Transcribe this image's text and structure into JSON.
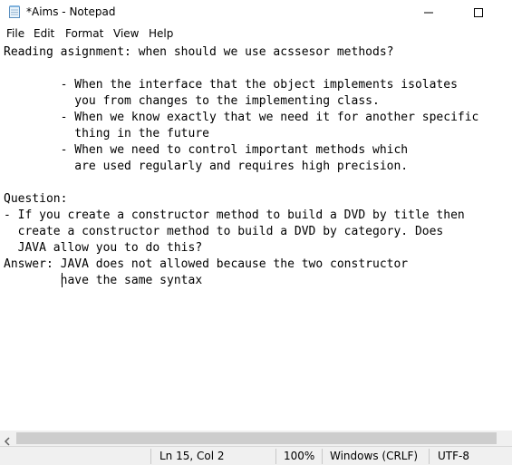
{
  "window": {
    "title": "*Aims - Notepad",
    "icon": "notepad-icon",
    "controls": [
      "minimize-icon",
      "maximize-icon"
    ]
  },
  "menu": {
    "items": [
      "File",
      "Edit",
      "Format",
      "View",
      "Help"
    ]
  },
  "editor": {
    "lines": [
      "Reading asignment: when should we use acssesor methods?",
      "",
      "        - When the interface that the object implements isolates",
      "          you from changes to the implementing class.",
      "        - When we know exactly that we need it for another specific",
      "          thing in the future",
      "        - When we need to control important methods which",
      "          are used regularly and requires high precision.",
      "",
      "Question:",
      "- If you create a constructor method to build a DVD by title then",
      "  create a constructor method to build a DVD by category. Does",
      "  JAVA allow you to do this?",
      "Answer: JAVA does not allowed because the two constructor",
      "        have the same syntax"
    ]
  },
  "status": {
    "position": "Ln 15, Col 2",
    "zoom": "100%",
    "line_ending": "Windows (CRLF)",
    "encoding": "UTF-8"
  }
}
